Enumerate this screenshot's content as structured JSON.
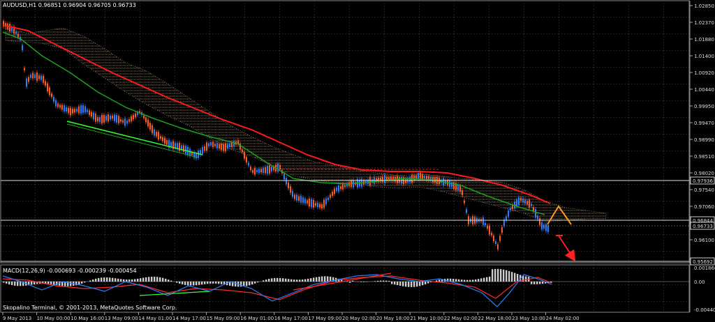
{
  "window": {
    "header": "AUDUSD,H1  0.96851 0.96904 0.96705 0.96733",
    "copyright": "Skopalino Terminal, © 2001-2013, MetaQuotes Software Corp."
  },
  "macd": {
    "label": "MACD(12,26,9) -0.000693 -0.000239 -0.000454",
    "ticks": [
      "0.001866",
      "0.00",
      "-0.004406"
    ]
  },
  "price_axis": {
    "ticks": [
      "1.02850",
      "1.02370",
      "1.01880",
      "1.01400",
      "1.00920",
      "1.00440",
      "0.99950",
      "0.99470",
      "0.98990",
      "0.98510",
      "0.98020",
      "0.97540",
      "0.97060",
      "0.96580",
      "0.96100"
    ],
    "levels": [
      {
        "label": "0.97936",
        "color": "#ffffff"
      },
      {
        "label": "0.96844",
        "color": "#ffffff"
      },
      {
        "label": "0.96733",
        "color": "#ffffff"
      },
      {
        "label": "0.95692",
        "color": "#ffffff"
      }
    ]
  },
  "time_axis": [
    "9 May 2013",
    "10 May 00:00",
    "10 May 16:00",
    "13 May 09:00",
    "14 May 01:00",
    "14 May 17:00",
    "15 May 09:00",
    "16 May 01:00",
    "16 May 17:00",
    "17 May 09:00",
    "20 May 02:00",
    "20 May 18:00",
    "21 May 10:00",
    "22 May 02:00",
    "22 May 18:00",
    "23 May 10:00",
    "24 May 02:00"
  ],
  "colors": {
    "bull": "#2a7fff",
    "bear": "#ff5a1f",
    "ma_red": "#ff1a1a",
    "ma_green": "#1aa31a",
    "cloud": "#c8b8a0",
    "grid": "#3a3a3a"
  }
}
